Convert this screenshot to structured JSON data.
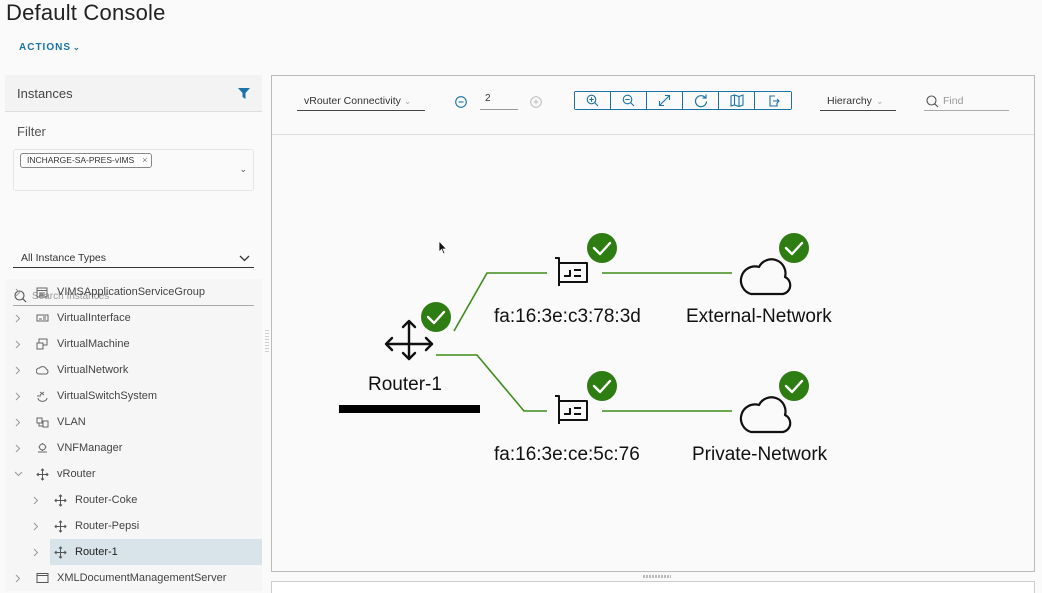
{
  "page": {
    "title": "Default Console",
    "actions_label": "ACTIONS"
  },
  "left_panel": {
    "header": "Instances",
    "filter_label": "Filter",
    "filter_chip": "INCHARGE-SA-PRES-vIMS",
    "instance_type": "All Instance Types",
    "search_placeholder": "Search Instances",
    "tree": [
      {
        "label": "VIMSApplicationServiceGroup",
        "icon": "server-group-icon",
        "level": 0,
        "expanded": false
      },
      {
        "label": "VirtualInterface",
        "icon": "network-card-icon",
        "level": 0,
        "expanded": false
      },
      {
        "label": "VirtualMachine",
        "icon": "virtual-machine-icon",
        "level": 0,
        "expanded": false
      },
      {
        "label": "VirtualNetwork",
        "icon": "cloud-icon",
        "level": 0,
        "expanded": false
      },
      {
        "label": "VirtualSwitchSystem",
        "icon": "switch-icon",
        "level": 0,
        "expanded": false
      },
      {
        "label": "VLAN",
        "icon": "vlan-icon",
        "level": 0,
        "expanded": false
      },
      {
        "label": "VNFManager",
        "icon": "gear-cloud-icon",
        "level": 0,
        "expanded": false
      },
      {
        "label": "vRouter",
        "icon": "router-icon",
        "level": 0,
        "expanded": true
      },
      {
        "label": "Router-Coke",
        "icon": "router-icon",
        "level": 1,
        "expanded": false
      },
      {
        "label": "Router-Pepsi",
        "icon": "router-icon",
        "level": 1,
        "expanded": false
      },
      {
        "label": "Router-1",
        "icon": "router-icon",
        "level": 1,
        "expanded": false,
        "selected": true
      },
      {
        "label": "XMLDocumentManagementServer",
        "icon": "window-icon",
        "level": 0,
        "expanded": false
      }
    ]
  },
  "toolbar": {
    "view": "vRouter Connectivity",
    "level": "2",
    "buttons": [
      "zoom-in",
      "zoom-out",
      "fit-to-screen",
      "refresh",
      "map",
      "export"
    ],
    "layout": "Hierarchy",
    "find_placeholder": "Find"
  },
  "topology": {
    "router": {
      "label": "Router-1",
      "status": "ok"
    },
    "interfaces": [
      {
        "label": "fa:16:3e:c3:78:3d",
        "status": "ok",
        "network": "External-Network",
        "network_status": "ok"
      },
      {
        "label": "fa:16:3e:ce:5c:76",
        "status": "ok",
        "network": "Private-Network",
        "network_status": "ok"
      }
    ],
    "colors": {
      "link": "#3d8c1a",
      "status_ok": "#2e7d12",
      "accent": "#1a73a8"
    }
  }
}
